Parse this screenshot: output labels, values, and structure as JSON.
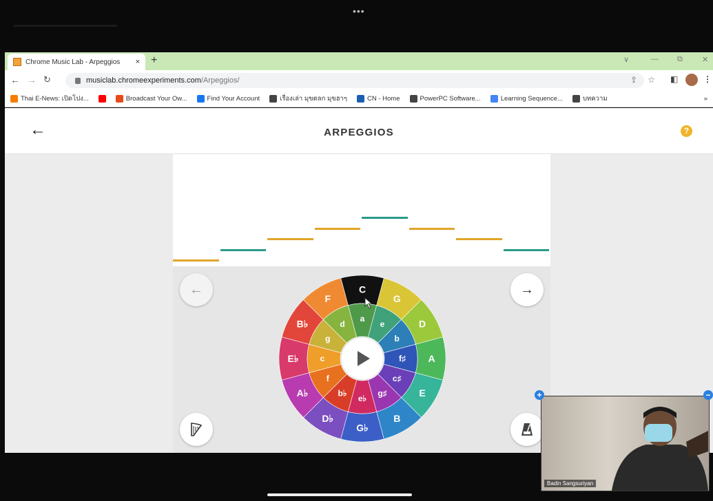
{
  "browser": {
    "tab_title": "Chrome Music Lab - Arpeggios",
    "tab_close": "×",
    "new_tab": "+",
    "url_host": "musiclab.chromeexperiments.com",
    "url_path": "/Arpeggios/",
    "window_controls": [
      "∨",
      "—",
      "⧉",
      "✕"
    ]
  },
  "bookmarks": [
    {
      "label": "Thai E-News: เปิดโปง...",
      "icon": "blogger-icon",
      "color": "#f57d00"
    },
    {
      "label": "",
      "icon": "youtube-icon",
      "color": "#ff0000"
    },
    {
      "label": "Broadcast Your Ow...",
      "icon": "broadcast-icon",
      "color": "#e64a19"
    },
    {
      "label": "Find Your Account",
      "icon": "facebook-icon",
      "color": "#1877f2"
    },
    {
      "label": "เรื่องเล่า มุขตลก มุขฮาๆ",
      "icon": "globe-icon",
      "color": "#444444"
    },
    {
      "label": "CN - Home",
      "icon": "cn-icon",
      "color": "#1a5fb4"
    },
    {
      "label": "PowerPC Software...",
      "icon": "globe-icon",
      "color": "#444444"
    },
    {
      "label": "Learning Sequence...",
      "icon": "google-icon",
      "color": "#4285f4"
    },
    {
      "label": "บทความ",
      "icon": "globe-icon",
      "color": "#444444"
    }
  ],
  "app": {
    "title": "ARPEGGIOS",
    "help": "?",
    "major_keys": [
      "C",
      "G",
      "D",
      "A",
      "E",
      "B",
      "G♭",
      "D♭",
      "A♭",
      "E♭",
      "B♭",
      "F"
    ],
    "minor_keys": [
      "a",
      "e",
      "b",
      "f♯",
      "c♯",
      "g♯",
      "e♭",
      "b♭",
      "f",
      "c",
      "g",
      "d"
    ],
    "selected_key": "C",
    "note_colors": [
      "#e0a52a",
      "#2a9a8a",
      "#e0a52a",
      "#e0a52a",
      "#2a9a8a",
      "#e0a52a",
      "#e0a52a",
      "#2a9a8a"
    ],
    "note_levels": [
      1,
      2,
      3,
      4,
      5,
      4,
      3,
      2
    ]
  },
  "video": {
    "participant": "Badin Sangsuriyan"
  }
}
